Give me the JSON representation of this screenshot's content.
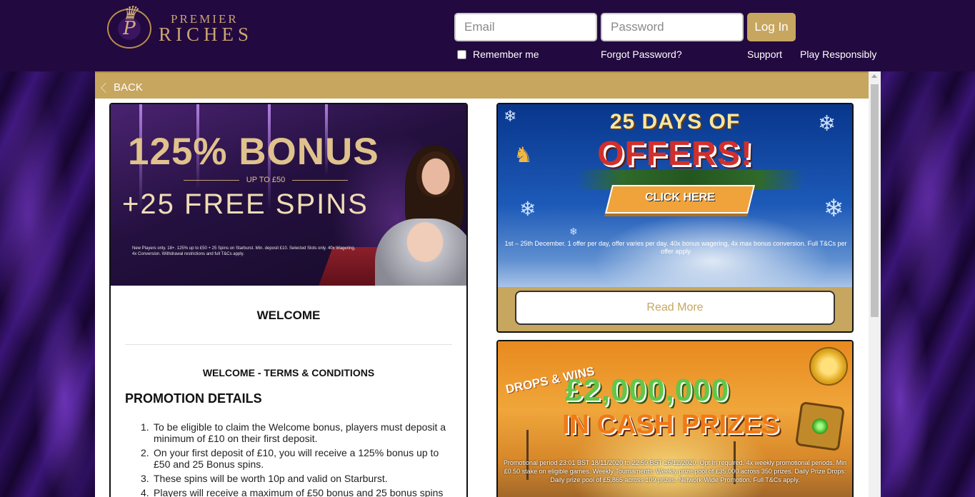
{
  "header": {
    "logo": {
      "top": "PREMIER",
      "bottom": "RICHES",
      "monogram": "P"
    },
    "email_placeholder": "Email",
    "password_placeholder": "Password",
    "login_label": "Log In",
    "remember_label": "Remember me",
    "forgot_label": "Forgot Password?",
    "support_label": "Support",
    "responsible_label": "Play Responsibly"
  },
  "back": {
    "label": "BACK"
  },
  "welcome_card": {
    "banner": {
      "title": "125% BONUS",
      "up_to": "UP TO £50",
      "spins": "+25 FREE SPINS",
      "terms": "New Players only. 18+. 125% up to £50 + 25 Spins on Starburst. Min. deposit £10. Selected Slots only. 40x Wagering, 4x Conversion. Withdrawal restrictions and full T&Cs apply."
    },
    "heading": "WELCOME",
    "terms_heading": "WELCOME - TERMS & CONDITIONS",
    "promo_heading": "PROMOTION DETAILS",
    "promo_items": [
      "To be eligible to claim the Welcome bonus, players must deposit a minimum of £10 on their first deposit.",
      "On your first deposit of £10, you will receive a 125% bonus up to £50 and 25 Bonus spins.",
      "These spins will be worth 10p and valid on Starburst.",
      "Players will receive a maximum of £50 bonus and 25 bonus spins"
    ]
  },
  "offers_card": {
    "line1": "25 DAYS OF",
    "line2": "OFFERS!",
    "cta": "CLICK HERE",
    "terms": "1st – 25th December. 1 offer per day, offer varies per day. 40x bonus wagering, 4x max bonus conversion. Full T&Cs per offer apply",
    "read_more": "Read More"
  },
  "drops_card": {
    "logo": "DROPS & WINS",
    "amount": "£2,000,000",
    "prize": "IN CASH PRIZES",
    "terms": "Promotional period 23:01 BST 18/11/2020 to 22:59 BST 16/12/2020. Opt In required. 4x weekly promotional periods. Min £0.50 stake on eligible games. Weekly Tournaments: Weekly prize pool of £35,000 across 350 prizes. Daily Prize Drops: Daily prize pool of £5,865 across 109 prizes. Network Wide Promotion. Full T&Cs apply."
  },
  "colors": {
    "header_bg": "#22093f",
    "gold": "#c7a65f",
    "white": "#ffffff"
  }
}
